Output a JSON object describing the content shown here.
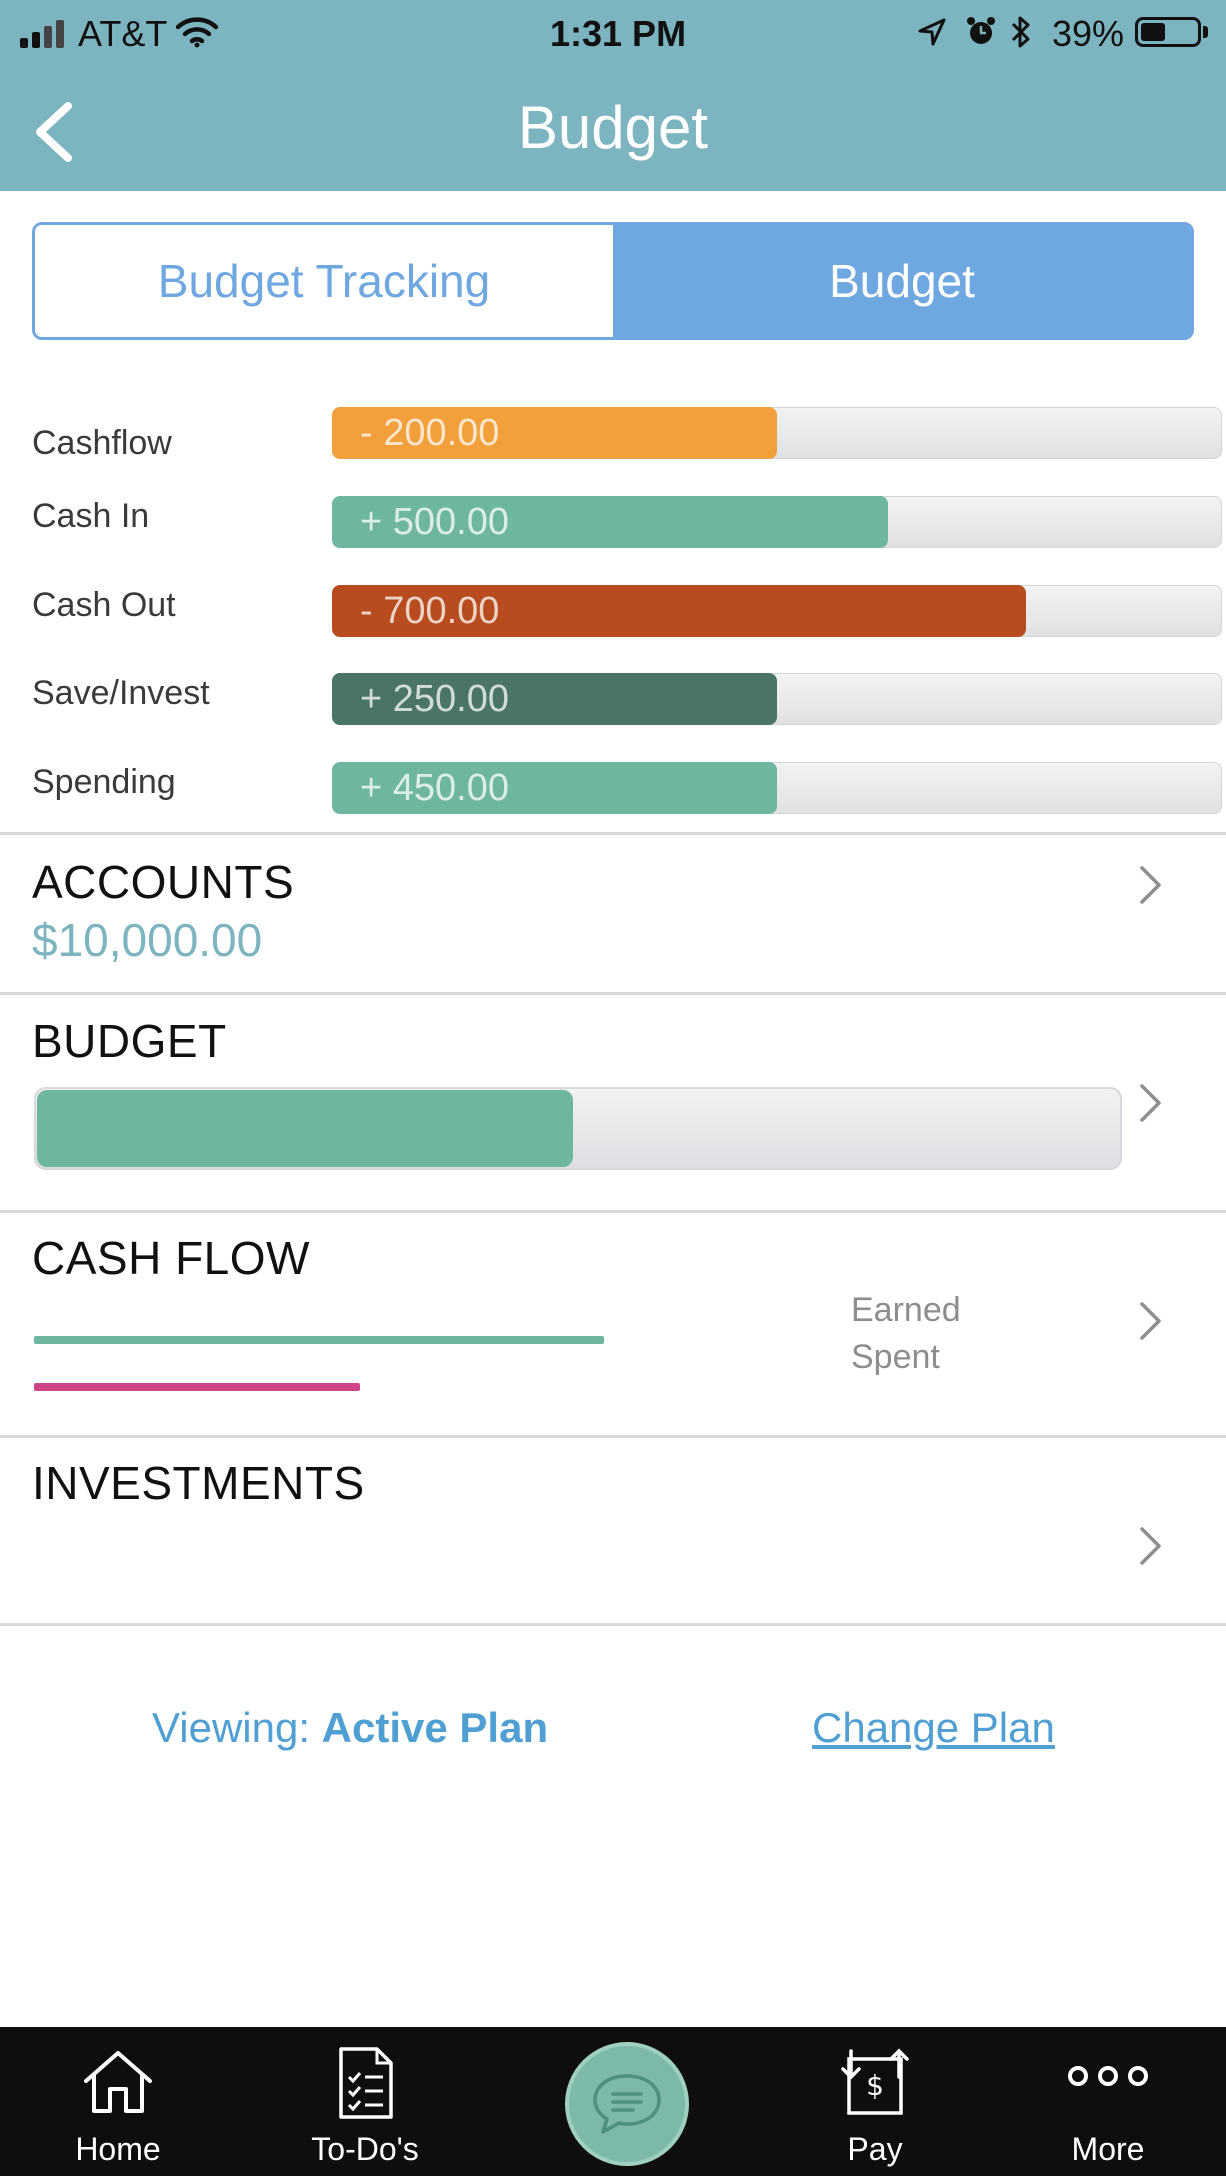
{
  "status_bar": {
    "carrier": "AT&T",
    "time": "1:31 PM",
    "battery": "39%",
    "icons": [
      "signal-icon",
      "wifi-icon",
      "location-icon",
      "alarm-icon",
      "bluetooth-icon",
      "battery-icon"
    ]
  },
  "header": {
    "title": "Budget",
    "back_icon": "chevron-left-icon"
  },
  "segments": {
    "tracking": "Budget Tracking",
    "budget": "Budget",
    "selected": "Budget"
  },
  "summary": [
    {
      "label": "Cashflow",
      "value": "- 200.00",
      "fraction": 0.5,
      "color": "#f2a03b"
    },
    {
      "label": "Cash In",
      "value": "+ 500.00",
      "fraction": 0.625,
      "color": "#6fb6a1"
    },
    {
      "label": "Cash Out",
      "value": "- 700.00",
      "fraction": 0.78,
      "color": "#b84c1f"
    },
    {
      "label": "Save/Invest",
      "value": "+ 250.00",
      "fraction": 0.5,
      "color": "#4a7565"
    },
    {
      "label": "Spending",
      "value": "+ 450.00",
      "fraction": 0.5,
      "color": "#6fb6a1"
    }
  ],
  "accounts": {
    "title": "ACCOUNTS",
    "amount": "$10,000.00"
  },
  "budget": {
    "title": "BUDGET",
    "fraction": 0.495,
    "color": "#6fb6a1"
  },
  "cash_flow": {
    "title": "CASH FLOW",
    "earned_label": "Earned",
    "spent_label": "Spent",
    "earned_color": "#6fb6a1",
    "spent_color": "#d04587",
    "earned_fraction": 0.525,
    "spent_fraction": 0.3
  },
  "investments": {
    "title": "INVESTMENTS"
  },
  "plan": {
    "viewing_label": "Viewing:",
    "plan_name": "Active Plan",
    "change_label": "Change Plan"
  },
  "tabbar": {
    "items": [
      {
        "label": "Home",
        "icon": "home-icon"
      },
      {
        "label": "To-Do's",
        "icon": "checklist-icon"
      },
      {
        "label": "",
        "icon": "chat-icon"
      },
      {
        "label": "Pay",
        "icon": "pay-icon"
      },
      {
        "label": "More",
        "icon": "more-icon"
      }
    ]
  },
  "colors": {
    "header": "#7cb5bf",
    "accent_blue": "#6fa8e0",
    "link_blue": "#4f9fd2"
  }
}
